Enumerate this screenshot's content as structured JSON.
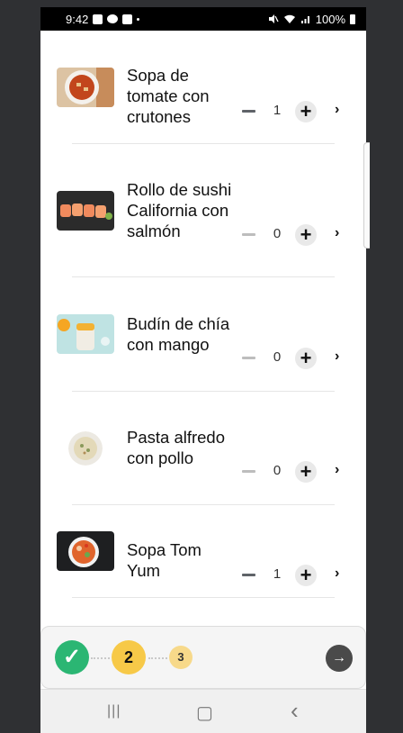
{
  "status_bar": {
    "time": "9:42",
    "battery": "100%"
  },
  "items": [
    {
      "name": "Sopa de tomate con crutones",
      "quantity": "1",
      "plus": "+",
      "chevron": "›",
      "minus_enabled": true,
      "image_icon": "tomato-soup-image"
    },
    {
      "name": "Rollo de sushi California con salmón",
      "quantity": "0",
      "plus": "+",
      "chevron": "›",
      "minus_enabled": false,
      "image_icon": "sushi-roll-image"
    },
    {
      "name": "Budín de chía con mango",
      "quantity": "0",
      "plus": "+",
      "chevron": "›",
      "minus_enabled": false,
      "image_icon": "chia-pudding-image"
    },
    {
      "name": "Pasta alfredo con pollo",
      "quantity": "0",
      "plus": "+",
      "chevron": "›",
      "minus_enabled": false,
      "image_icon": "pasta-alfredo-image"
    },
    {
      "name": "Sopa Tom Yum",
      "quantity": "1",
      "plus": "+",
      "chevron": "›",
      "minus_enabled": true,
      "image_icon": "tom-yum-image"
    }
  ],
  "stepper": {
    "step1_icon": "✓",
    "step2_label": "2",
    "step3_label": "3",
    "next_icon": "→",
    "colors": {
      "done": "#2bb673",
      "current": "#f7c948",
      "upcoming": "#f7d98a",
      "next_button": "#4a4a4a"
    }
  },
  "nav_bar": {
    "recents_icon": "|||",
    "home_icon": "▢",
    "back_icon": "‹"
  }
}
